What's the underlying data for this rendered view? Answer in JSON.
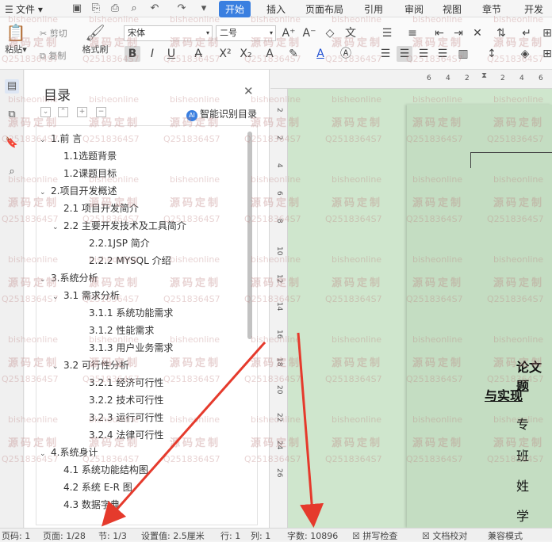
{
  "menubar": {
    "file_label": "文件",
    "tabs": [
      "开始",
      "插入",
      "页面布局",
      "引用",
      "审阅",
      "视图",
      "章节",
      "开发工"
    ],
    "active_tab": "开始"
  },
  "ribbon": {
    "paste": "粘贴",
    "cut": "剪切",
    "copy": "复制",
    "format_painter": "格式刷",
    "font_name": "宋体",
    "font_size": "二号"
  },
  "toc_panel": {
    "title": "目录",
    "smart_button": "智能识别目录",
    "items": [
      {
        "text": "1.前 言",
        "level": 1,
        "expanded": true
      },
      {
        "text": "1.1选题背景",
        "level": 2
      },
      {
        "text": "1.2课题目标",
        "level": 2
      },
      {
        "text": "2.项目开发概述",
        "level": 1,
        "expanded": true
      },
      {
        "text": "2.1 项目开发简介",
        "level": 2
      },
      {
        "text": "2.2 主要开发技术及工具简介",
        "level": 2,
        "expanded": true
      },
      {
        "text": "2.2.1JSP 简介",
        "level": 3
      },
      {
        "text": "2.2.2 MYSQL 介绍",
        "level": 3
      },
      {
        "text": "3.系统分析",
        "level": 1,
        "expanded": true
      },
      {
        "text": "3.1 需求分析",
        "level": 2,
        "expanded": true
      },
      {
        "text": "3.1.1 系统功能需求",
        "level": 3
      },
      {
        "text": "3.1.2 性能需求",
        "level": 3
      },
      {
        "text": "3.1.3 用户业务需求",
        "level": 3
      },
      {
        "text": "3.2 可行性分析",
        "level": 2,
        "expanded": true
      },
      {
        "text": "3.2.1  经济可行性",
        "level": 3
      },
      {
        "text": "3.2.2  技术可行性",
        "level": 3
      },
      {
        "text": "3.2.3 运行可行性",
        "level": 3
      },
      {
        "text": "3.2.4  法律可行性",
        "level": 3
      },
      {
        "text": "4.系统身计",
        "level": 1,
        "expanded": true
      },
      {
        "text": "4.1  系统功能结构图",
        "level": 2
      },
      {
        "text": "4.2  系统 E-R 图",
        "level": 2
      },
      {
        "text": "4.3  数据字典",
        "level": 2
      }
    ]
  },
  "ruler": {
    "h_ticks": [
      "6",
      "4",
      "2",
      "2",
      "4",
      "6"
    ],
    "v_ticks": [
      "2",
      "2",
      "4",
      "6",
      "8",
      "10",
      "12",
      "14",
      "16",
      "18",
      "20",
      "22",
      "24",
      "26"
    ]
  },
  "document": {
    "lines": [
      "论文题",
      "与实现",
      "专",
      "班",
      "姓",
      "学"
    ]
  },
  "watermark": {
    "texts": [
      "bisheonline",
      "源码定制",
      "Q2518364S7"
    ]
  },
  "statusbar": {
    "page_num": "页码: 1",
    "page": "页面: 1/28",
    "section": "节: 1/3",
    "setting": "设置值: 2.5厘米",
    "row": "行: 1",
    "col": "列: 1",
    "word_count": "字数: 10896",
    "spell_check": "拼写检查",
    "doc_proof": "文档校对",
    "compat": "兼容模式"
  },
  "colors": {
    "accent": "#3a7fe0",
    "doc_bg": "#cfe6cd",
    "arrow": "#e53a2c"
  }
}
